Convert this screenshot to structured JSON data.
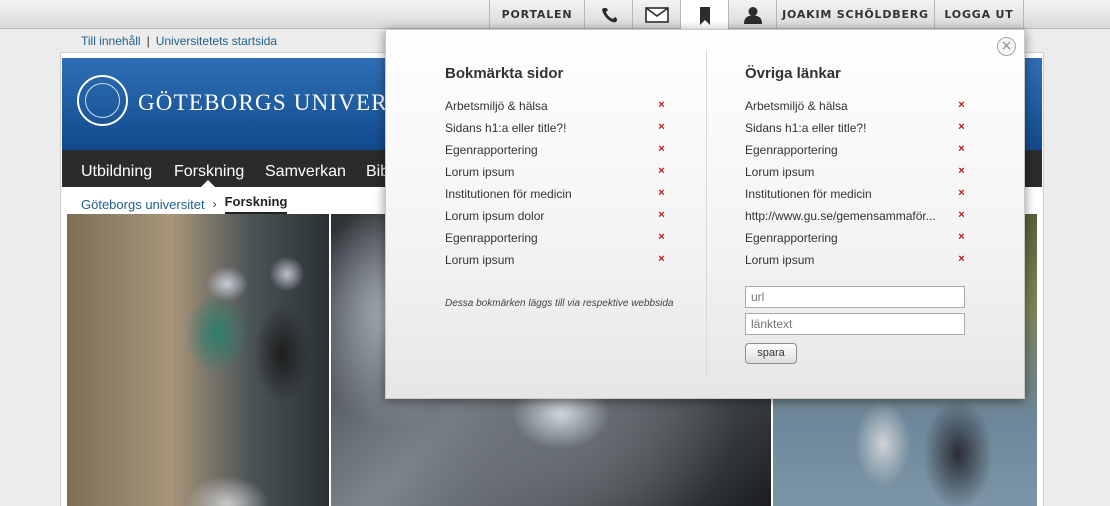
{
  "toolbar": {
    "portal_label": "PORTALEN",
    "user_label": "JOAKIM SCHÖLDBERG",
    "logout_label": "LOGGA UT",
    "icons": [
      "phone-icon",
      "mail-icon",
      "bookmark-icon",
      "user-icon"
    ]
  },
  "skip_links": {
    "content": "Till innehåll",
    "separator": "|",
    "start": "Universitetets startsida"
  },
  "header": {
    "university_name": "GÖTEBORGS UNIVERSITET"
  },
  "nav": {
    "items": [
      "Utbildning",
      "Forskning",
      "Samverkan",
      "Bib"
    ],
    "active": "Forskning"
  },
  "breadcrumb": {
    "root": "Göteborgs universitet",
    "separator": "›",
    "current": "Forskning"
  },
  "popup": {
    "close_symbol": "×",
    "bookmarks": {
      "title": "Bokmärkta sidor",
      "items": [
        "Arbetsmiljö & hälsa",
        "Sidans h1:a eller title?!",
        "Egenrapportering",
        "Lorum ipsum",
        "Institutionen för medicin",
        "Lorum ipsum dolor",
        "Egenrapportering",
        "Lorum ipsum"
      ],
      "note": "Dessa bokmärken läggs till via respektive webbsida"
    },
    "other_links": {
      "title": "Övriga länkar",
      "items": [
        "Arbetsmiljö & hälsa",
        "Sidans h1:a eller title?!",
        "Egenrapportering",
        "Lorum ipsum",
        "Institutionen för medicin",
        "http://www.gu.se/gemensammaför...",
        "Egenrapportering",
        "Lorum ipsum"
      ],
      "url_placeholder": "url",
      "text_placeholder": "länktext",
      "save_label": "spara"
    },
    "remove_symbol": "×"
  },
  "colors": {
    "header_blue": "#1b5a9e",
    "nav_dark": "#2b2b2b",
    "link_blue": "#1f5f8b",
    "remove_red": "#c0161b"
  }
}
